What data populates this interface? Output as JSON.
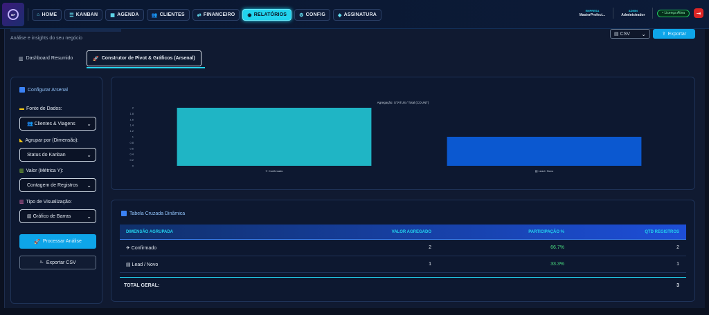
{
  "nav": {
    "items": [
      {
        "icon": "⌂",
        "label": "HOME"
      },
      {
        "icon": "☰",
        "label": "KANBAN"
      },
      {
        "icon": "▦",
        "label": "AGENDA"
      },
      {
        "icon": "👥",
        "label": "CLIENTES"
      },
      {
        "icon": "⇄",
        "label": "FINANCEIRO"
      },
      {
        "icon": "◉",
        "label": "RELATÓRIOS"
      },
      {
        "icon": "⚙",
        "label": "CONFIG"
      },
      {
        "icon": "◈",
        "label": "ASSINATURA"
      }
    ],
    "active": "RELATÓRIOS"
  },
  "header": {
    "company_label": "EMPRESA",
    "company_value": "MasterProfect...",
    "user_label": "ADMIN",
    "user_value": "Administrador",
    "status": "• Licença Ativa"
  },
  "page": {
    "subtitle": "Análise e insights do seu negócio",
    "format_select": "CSV",
    "export_label": "Exportar"
  },
  "tabs": [
    {
      "icon": "▥",
      "label": "Dashboard Resumido"
    },
    {
      "icon": "🚀",
      "label": "Construtor de Pivot & Gráficos (Arsenal)"
    }
  ],
  "config": {
    "title": "Configurar Arsenal",
    "source_label": "Fonte de Dados:",
    "source_value": "Clientes & Viagens",
    "group_label": "Agrupar por (Dimensão):",
    "group_value": "Status do Kanban",
    "metric_label": "Valor (Métrica Y):",
    "metric_value": "Contagem de Registros",
    "viz_label": "Tipo de Visualização:",
    "viz_value": "Gráfico de Barras",
    "process_label": "Processar Análise",
    "csv_label": "Exportar CSV"
  },
  "chart_data": {
    "type": "bar",
    "title": "Agregação: STATUS / Total (COUNT)",
    "categories": [
      "✈ Confirmado",
      "▤ Lead / Novo"
    ],
    "values": [
      2,
      1
    ],
    "ylim": [
      0,
      2
    ],
    "yticks": [
      "2",
      "1.8",
      "1.6",
      "1.4",
      "1.2",
      "1",
      "0.8",
      "0.6",
      "0.4",
      "0.2",
      "0"
    ],
    "colors": [
      "#1fb5c5",
      "#0b58d0"
    ],
    "grid": false
  },
  "table": {
    "title": "Tabela Cruzada Dinâmica",
    "headers": [
      "DIMENSÃO AGRUPADA",
      "VALOR AGREGADO",
      "PARTICIPAÇÃO %",
      "QTD REGISTROS"
    ],
    "rows": [
      {
        "dim": "✈ Confirmado",
        "value": "2",
        "pct": "66.7%",
        "count": "2"
      },
      {
        "dim": "▤ Lead / Novo",
        "value": "1",
        "pct": "33.3%",
        "count": "1"
      }
    ],
    "total_label": "TOTAL GERAL:",
    "total_value": "3"
  }
}
